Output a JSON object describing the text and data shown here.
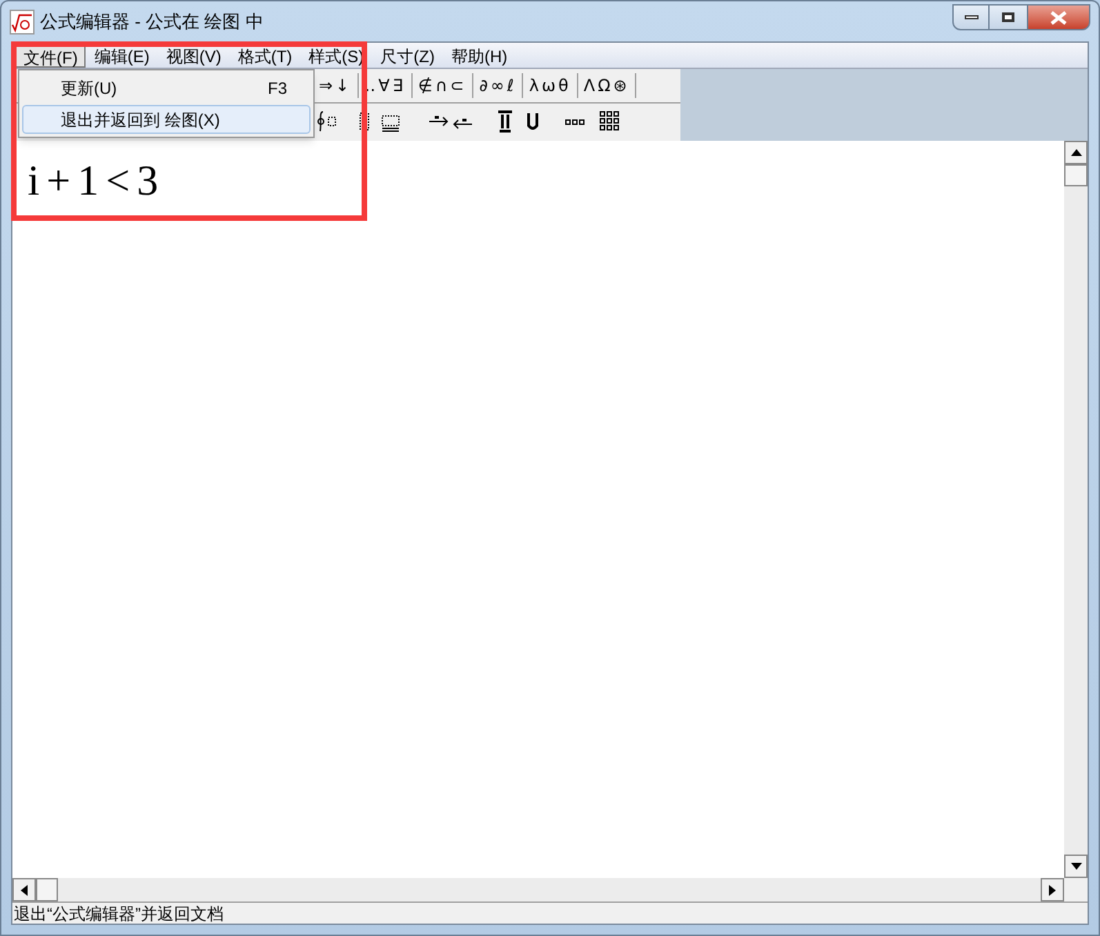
{
  "window": {
    "title": "公式编辑器 - 公式在 绘图 中"
  },
  "menu": [
    {
      "label": "文件(F)",
      "selected": true
    },
    {
      "label": "编辑(E)",
      "selected": false
    },
    {
      "label": "视图(V)",
      "selected": false
    },
    {
      "label": "格式(T)",
      "selected": false
    },
    {
      "label": "样式(S)",
      "selected": false
    },
    {
      "label": "尺寸(Z)",
      "selected": false
    },
    {
      "label": "帮助(H)",
      "selected": false
    }
  ],
  "dropdown": [
    {
      "label": "更新(U)",
      "shortcut": "F3",
      "selected": false
    },
    {
      "label": "退出并返回到 绘图(X)",
      "selected": true
    }
  ],
  "toolbar_row_1": [
    "⇒↓",
    "‥∀∃",
    "∉∩⊂",
    "∂∞ℓ",
    "λωθ",
    "ΛΩ⊛"
  ],
  "equation": "i+1<3",
  "status_bar": "退出“公式编辑器”并返回文档"
}
